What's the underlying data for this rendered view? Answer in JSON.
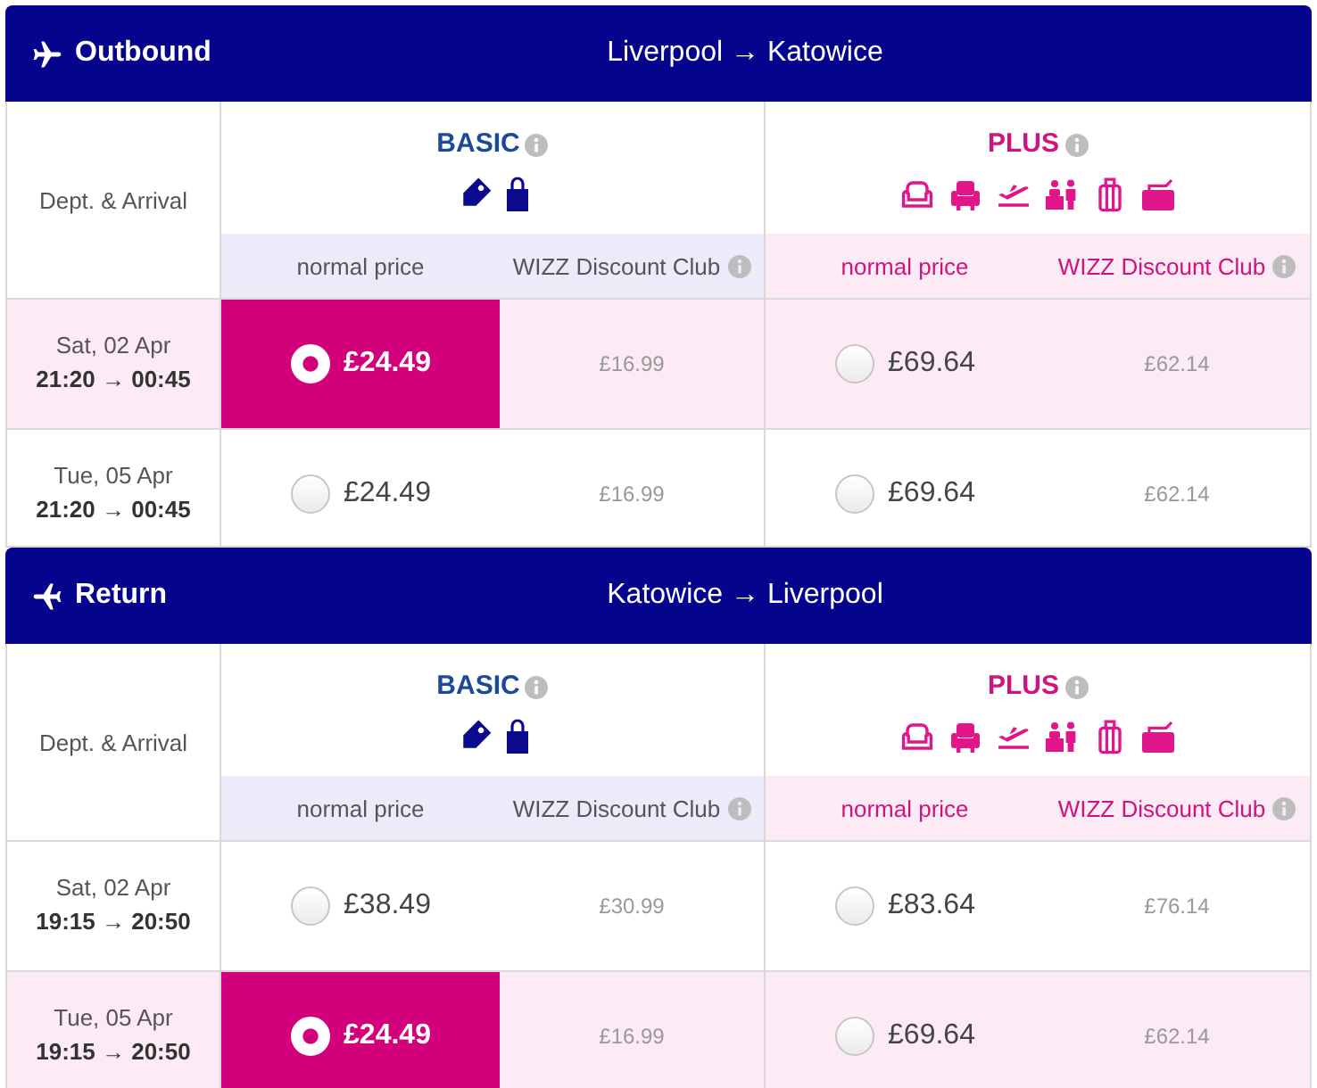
{
  "sections": [
    {
      "kind": "outbound",
      "title": "Outbound",
      "route": "Liverpool → Katowice",
      "time_heading": "Dept. & Arrival",
      "fares": [
        {
          "kind": "basic",
          "name": "BASIC",
          "info": true,
          "columns": [
            {
              "label": "normal price",
              "info": false
            },
            {
              "label": "WIZZ Discount Club",
              "info": true
            }
          ]
        },
        {
          "kind": "plus",
          "name": "PLUS",
          "info": true,
          "columns": [
            {
              "label": "normal price",
              "info": false
            },
            {
              "label": "WIZZ Discount Club",
              "info": true
            }
          ]
        }
      ],
      "flights": [
        {
          "date": "Sat, 02 Apr",
          "times": "21:20 → 00:45",
          "prices": [
            {
              "normal": "£24.49",
              "club": "£16.99",
              "selected": true
            },
            {
              "normal": "£69.64",
              "club": "£62.14",
              "selected": false
            }
          ]
        },
        {
          "date": "Tue, 05 Apr",
          "times": "21:20 → 00:45",
          "prices": [
            {
              "normal": "£24.49",
              "club": "£16.99",
              "selected": false
            },
            {
              "normal": "£69.64",
              "club": "£62.14",
              "selected": false
            }
          ]
        }
      ]
    },
    {
      "kind": "return",
      "title": "Return",
      "route": "Katowice → Liverpool",
      "time_heading": "Dept. & Arrival",
      "fares": [
        {
          "kind": "basic",
          "name": "BASIC",
          "info": true,
          "columns": [
            {
              "label": "normal price",
              "info": false
            },
            {
              "label": "WIZZ Discount Club",
              "info": true
            }
          ]
        },
        {
          "kind": "plus",
          "name": "PLUS",
          "info": true,
          "columns": [
            {
              "label": "normal price",
              "info": false
            },
            {
              "label": "WIZZ Discount Club",
              "info": true
            }
          ]
        }
      ],
      "flights": [
        {
          "date": "Sat, 02 Apr",
          "times": "19:15 → 20:50",
          "prices": [
            {
              "normal": "£38.49",
              "club": "£30.99",
              "selected": false
            },
            {
              "normal": "£83.64",
              "club": "£76.14",
              "selected": false
            }
          ]
        },
        {
          "date": "Tue, 05 Apr",
          "times": "19:15 → 20:50",
          "prices": [
            {
              "normal": "£24.49",
              "club": "£16.99",
              "selected": true
            },
            {
              "normal": "£69.64",
              "club": "£62.14",
              "selected": false
            }
          ]
        }
      ]
    }
  ]
}
